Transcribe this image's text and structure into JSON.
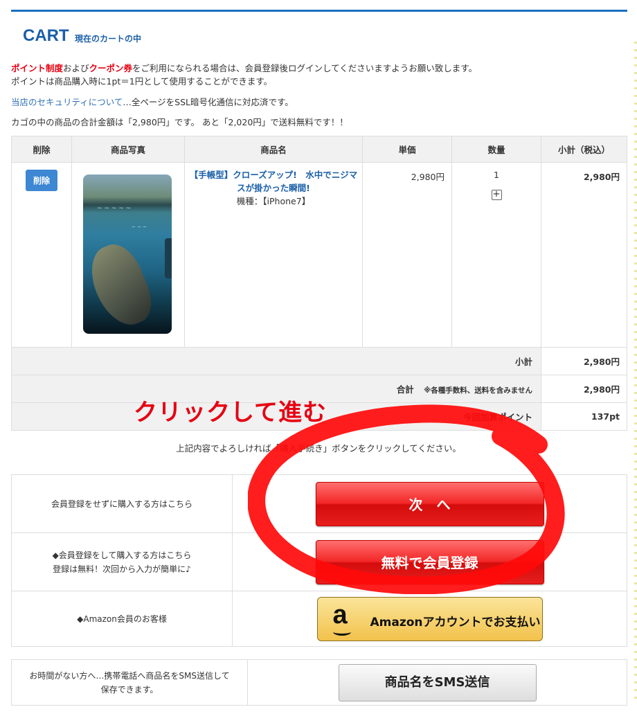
{
  "header": {
    "title": "CART",
    "subtitle": "現在のカートの中"
  },
  "notices": {
    "line1_a": "ポイント制度",
    "line1_b": "および",
    "line1_c": "クーポン券",
    "line1_d": "をご利用になられる場合は、会員登録後ログインしてくださいますようお願い致します。",
    "line2": "ポイントは商品購入時に1pt＝1円として使用することができます。",
    "security_link": "当店のセキュリティについて",
    "security_text": "…全ページをSSL暗号化通信に対応済です。",
    "total_message": "カゴの中の商品の合計金額は「2,980円」です。 あと「2,020円」で送料無料です！！"
  },
  "table": {
    "headers": [
      "削除",
      "商品写真",
      "商品名",
      "単価",
      "数量",
      "小計（税込）"
    ],
    "item": {
      "delete_label": "削除",
      "name": "【手帳型】クローズアップ!　水中でニジマスが掛かった瞬間!",
      "model": "機種：【iPhone7】",
      "unit_price": "2,980円",
      "quantity": "1",
      "plus": "+",
      "subtotal": "2,980円"
    },
    "summary": {
      "subtotal_label": "小計",
      "subtotal_value": "2,980円",
      "total_label": "合計",
      "total_note": "※各種手数料、送料を含みません",
      "total_value": "2,980円",
      "points_label": "今回加算ポイント",
      "points_value": "137pt"
    }
  },
  "annotation": {
    "text": "クリックして進む",
    "color": "#e60012"
  },
  "instruction": "上記内容でよろしければ「購入手続き」ボタンをクリックしてください。",
  "actions": [
    {
      "label": "会員登録をせずに購入する方はこちら",
      "button": "次　へ"
    },
    {
      "label_line1": "◆会員登録をして購入する方はこちら",
      "label_line2": "登録は無料！次回から入力が簡単に♪",
      "button": "無料で会員登録"
    },
    {
      "label": "◆Amazon会員のお客様",
      "button": "Amazonアカウントでお支払い"
    }
  ],
  "sms": {
    "label_line1": "お時間がない方へ…携帯電話へ商品名をSMS送信して",
    "label_line2": "保存できます。",
    "button": "商品名をSMS送信"
  },
  "colors": {
    "accent": "#1a5fa8",
    "red": "#e60012"
  }
}
